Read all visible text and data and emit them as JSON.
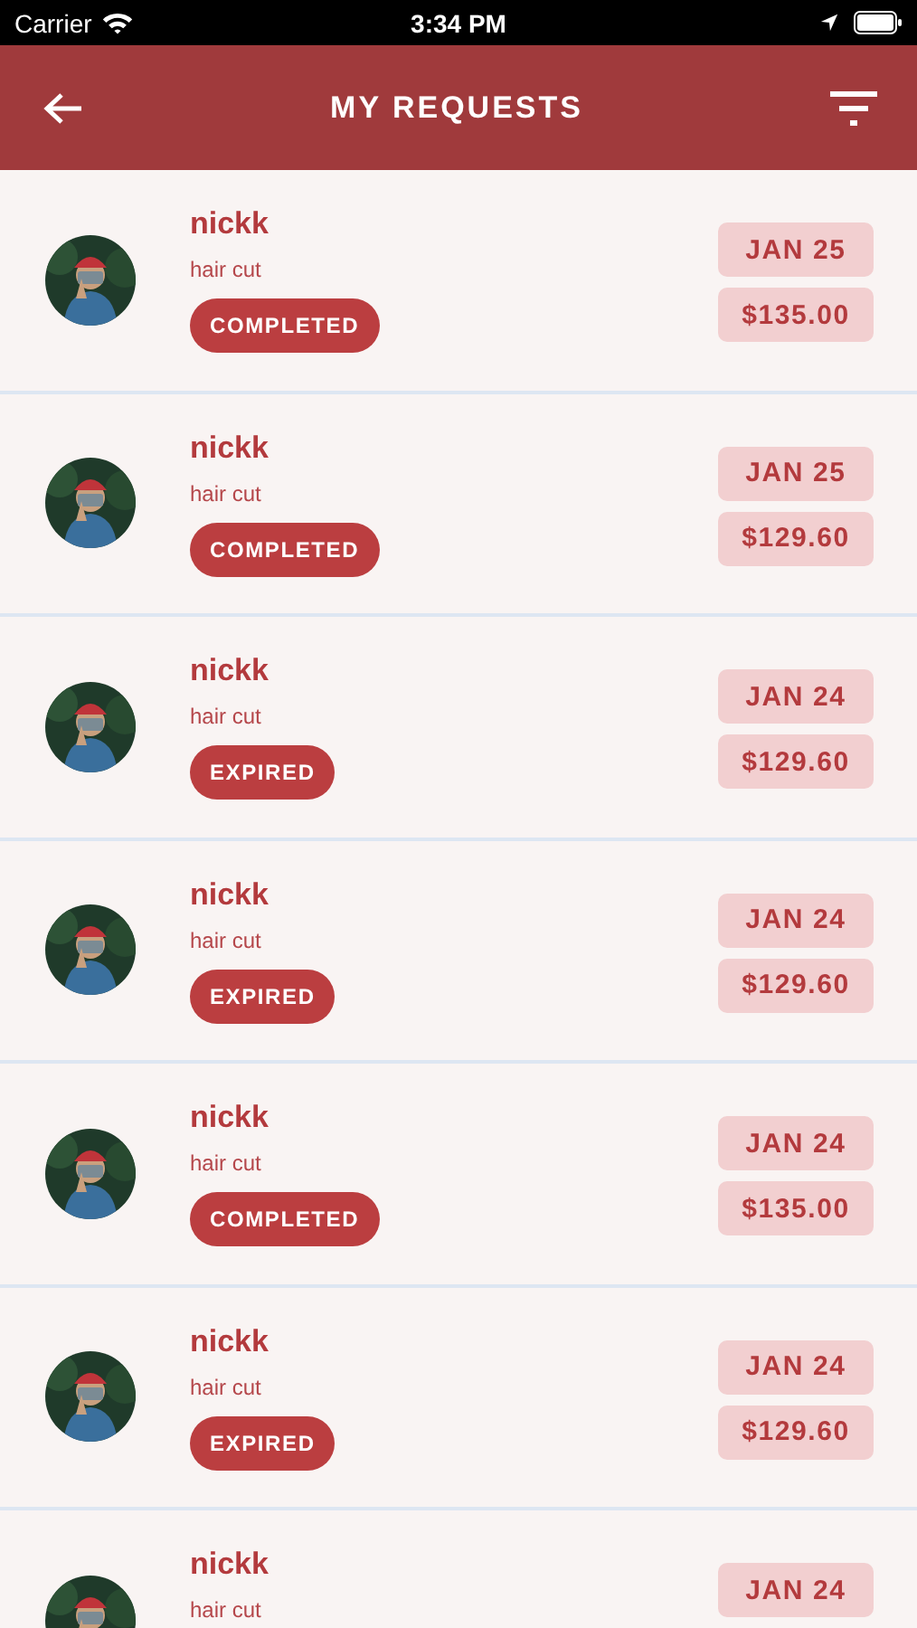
{
  "status_bar": {
    "carrier": "Carrier",
    "time": "3:34 PM"
  },
  "header": {
    "title": "MY REQUESTS"
  },
  "requests": [
    {
      "name": "nickk",
      "service": "hair cut",
      "status": "COMPLETED",
      "date": "JAN 25",
      "price": "$135.00"
    },
    {
      "name": "nickk",
      "service": "hair cut",
      "status": "COMPLETED",
      "date": "JAN 25",
      "price": "$129.60"
    },
    {
      "name": "nickk",
      "service": "hair cut",
      "status": "EXPIRED",
      "date": "JAN 24",
      "price": "$129.60"
    },
    {
      "name": "nickk",
      "service": "hair cut",
      "status": "EXPIRED",
      "date": "JAN 24",
      "price": "$129.60"
    },
    {
      "name": "nickk",
      "service": "hair cut",
      "status": "COMPLETED",
      "date": "JAN 24",
      "price": "$135.00"
    },
    {
      "name": "nickk",
      "service": "hair cut",
      "status": "EXPIRED",
      "date": "JAN 24",
      "price": "$129.60"
    },
    {
      "name": "nickk",
      "service": "hair cut",
      "date": "JAN 24"
    }
  ]
}
